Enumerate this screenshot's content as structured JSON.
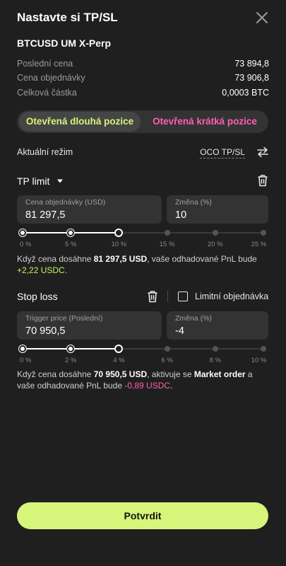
{
  "dialog": {
    "title": "Nastavte si TP/SL"
  },
  "instrument": "BTCUSD UM X-Perp",
  "info": [
    {
      "label": "Poslední cena",
      "value": "73 894,8"
    },
    {
      "label": "Cena objednávky",
      "value": "73 906,8"
    },
    {
      "label": "Celková částka",
      "value": "0,0003 BTC"
    }
  ],
  "position_toggle": {
    "long": "Otevřená dlouhá pozice",
    "short": "Otevřená krátká pozice",
    "selected": "long"
  },
  "mode": {
    "label": "Aktuální režim",
    "value": "OCO TP/SL"
  },
  "tp": {
    "title": "TP limit",
    "price_label": "Cena objednávky (USD)",
    "price_value": "81 297,5",
    "change_label": "Změna (%)",
    "change_value": "10",
    "slider_value_percent": 10,
    "ticks": [
      "0 %",
      "5 %",
      "10 %",
      "15 %",
      "20 %",
      "25 %"
    ],
    "msg_prefix": "Když cena dosáhne ",
    "msg_price": "81 297,5 USD",
    "msg_mid": ", vaše odhadované PnL bude",
    "msg_pnl": "+2,22 USDC",
    "msg_end": "."
  },
  "sl": {
    "title": "Stop loss",
    "limit_label": "Limitní objednávka",
    "price_label": "Trigger price (Poslední)",
    "price_value": "70 950,5",
    "change_label": "Změna (%)",
    "change_value": "-4",
    "slider_value_percent": 4,
    "ticks": [
      "0 %",
      "2 %",
      "4 %",
      "6 %",
      "8 %",
      "10 %"
    ],
    "msg_prefix": "Když cena dosáhne ",
    "msg_price": "70 950,5 USD",
    "msg_mid": ", aktivuje se ",
    "msg_order": "Market order",
    "msg_mid2": " a vaše odhadované PnL bude ",
    "msg_pnl": "-0,89 USDC",
    "msg_end": "."
  },
  "confirm_label": "Potvrdit",
  "colors": {
    "accent": "#d7f57a",
    "long": "#d7f57a",
    "short": "#ff5fb2",
    "positive": "#c4f25a",
    "negative": "#ff5fb2"
  },
  "icons": {
    "close": "close-icon",
    "caret": "caret-down-icon",
    "trash": "trash-icon",
    "swap": "swap-icon"
  }
}
